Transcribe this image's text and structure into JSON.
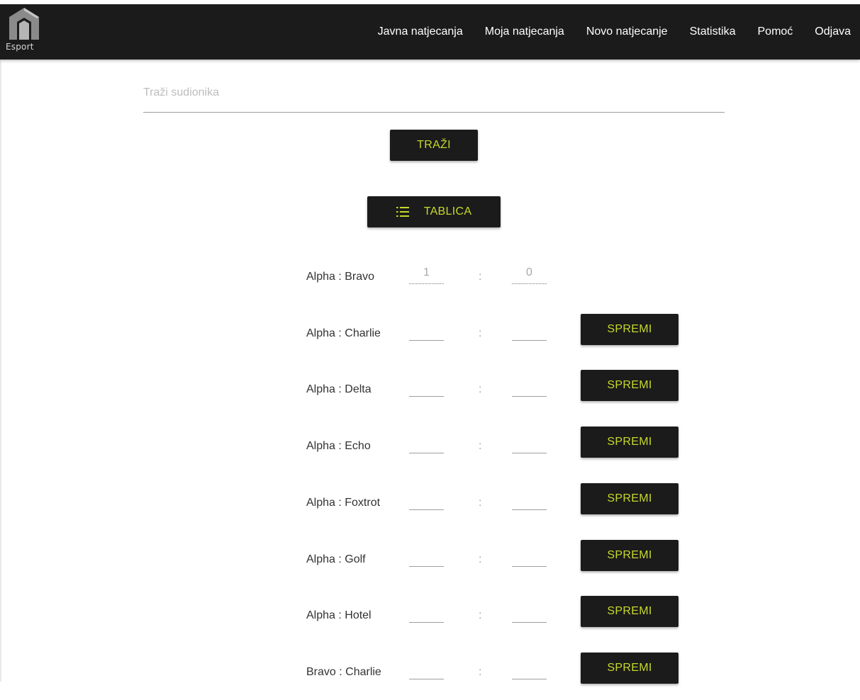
{
  "brand": {
    "logo_text": "Esport"
  },
  "nav": {
    "items": [
      {
        "label": "Javna natjecanja"
      },
      {
        "label": "Moja natjecanja"
      },
      {
        "label": "Novo natjecanje"
      },
      {
        "label": "Statistika"
      },
      {
        "label": "Pomoć"
      },
      {
        "label": "Odjava"
      }
    ]
  },
  "search": {
    "placeholder": "Traži sudionika",
    "value": "",
    "button_label": "TRAŽI"
  },
  "table_button": {
    "label": "TABLICA",
    "icon": "list-icon"
  },
  "matches": [
    {
      "label": "Alpha : Bravo",
      "home_score": "1",
      "away_score": "0",
      "saved": true
    },
    {
      "label": "Alpha : Charlie",
      "home_score": "",
      "away_score": "",
      "saved": false,
      "button_label": "SPREMI"
    },
    {
      "label": "Alpha : Delta",
      "home_score": "",
      "away_score": "",
      "saved": false,
      "button_label": "SPREMI"
    },
    {
      "label": "Alpha : Echo",
      "home_score": "",
      "away_score": "",
      "saved": false,
      "button_label": "SPREMI"
    },
    {
      "label": "Alpha : Foxtrot",
      "home_score": "",
      "away_score": "",
      "saved": false,
      "button_label": "SPREMI"
    },
    {
      "label": "Alpha : Golf",
      "home_score": "",
      "away_score": "",
      "saved": false,
      "button_label": "SPREMI"
    },
    {
      "label": "Alpha : Hotel",
      "home_score": "",
      "away_score": "",
      "saved": false,
      "button_label": "SPREMI"
    },
    {
      "label": "Bravo : Charlie",
      "home_score": "",
      "away_score": "",
      "saved": false,
      "button_label": "SPREMI"
    }
  ],
  "colors": {
    "navbar": "#1b1b1b",
    "accent": "#c6d92b",
    "text": "#333333"
  }
}
